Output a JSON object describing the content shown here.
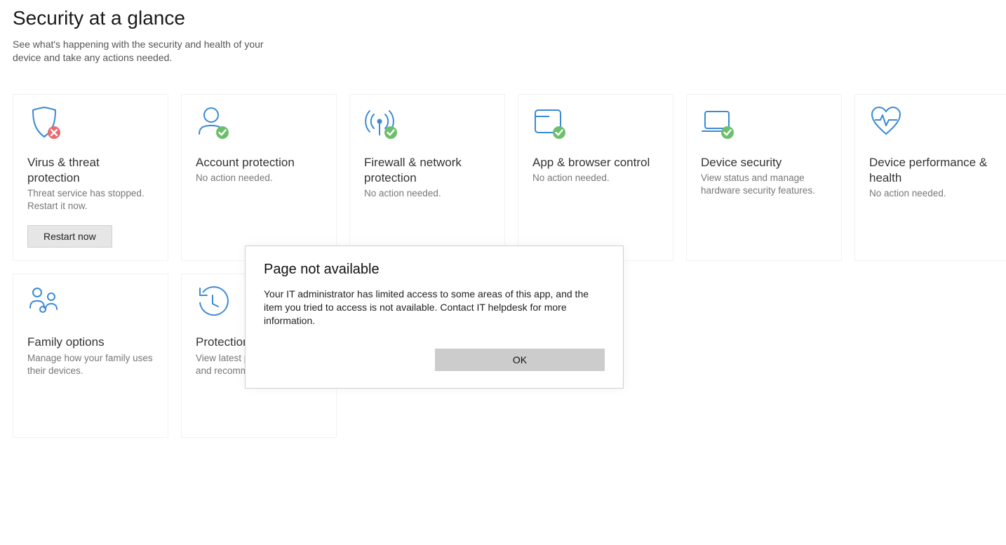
{
  "header": {
    "title": "Security at a glance",
    "subtitle": "See what's happening with the security and health of your device and take any actions needed."
  },
  "cards": {
    "virus": {
      "title": "Virus & threat protection",
      "desc": "Threat service has stopped. Restart it now.",
      "button": "Restart now"
    },
    "account": {
      "title": "Account protection",
      "desc": "No action needed."
    },
    "firewall": {
      "title": "Firewall & network protection",
      "desc": "No action needed."
    },
    "app": {
      "title": "App & browser control",
      "desc": "No action needed."
    },
    "device_sec": {
      "title": "Device security",
      "desc": "View status and manage hardware security features."
    },
    "device_perf": {
      "title": "Device performance & health",
      "desc": "No action needed."
    },
    "family": {
      "title": "Family options",
      "desc": "Manage how your family uses their devices."
    },
    "history": {
      "title": "Protection history",
      "desc": "View latest protection actions and recommendations."
    }
  },
  "dialog": {
    "title": "Page not available",
    "body": "Your IT administrator has limited access to some areas of this app, and the item you tried to access is not available. Contact IT helpdesk for more information.",
    "ok": "OK"
  },
  "colors": {
    "icon_blue": "#3a8ad6",
    "badge_green": "#6cbf6c",
    "badge_red": "#e96b6f"
  }
}
